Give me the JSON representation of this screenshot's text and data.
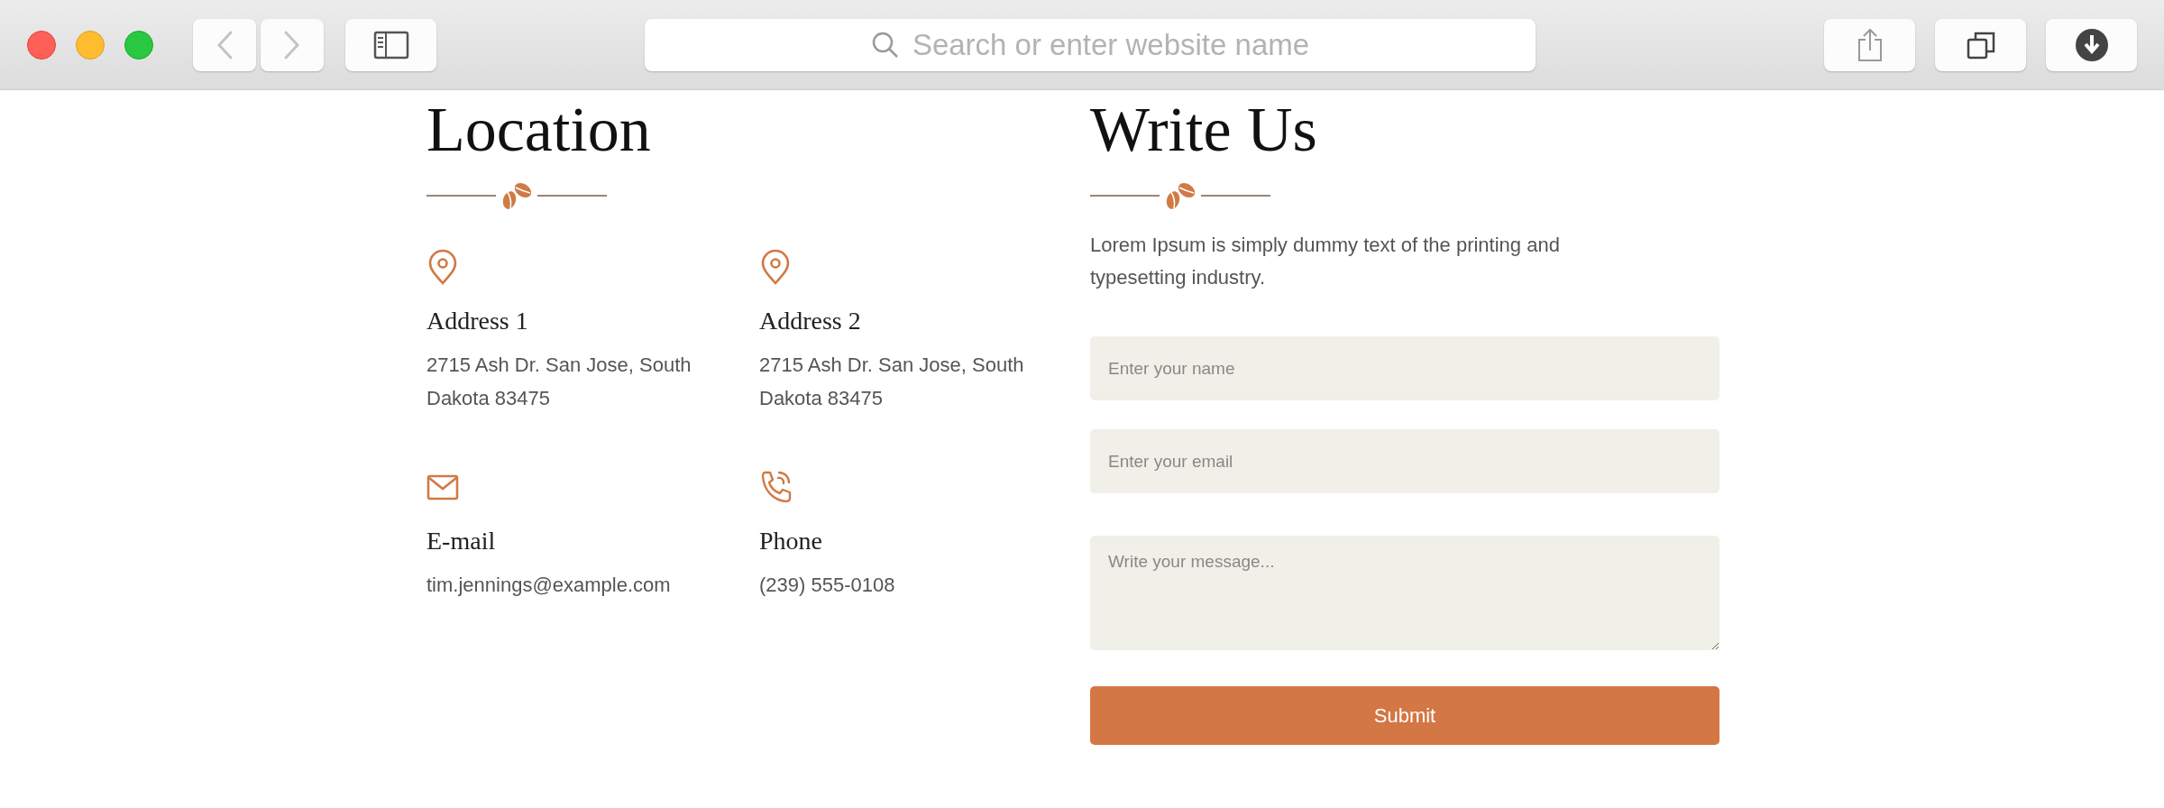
{
  "browser": {
    "search_placeholder": "Search or enter website name"
  },
  "location": {
    "title": "Location",
    "items": [
      {
        "kind": "pin",
        "title": "Address 1",
        "text": "2715 Ash Dr. San Jose, South Dakota 83475"
      },
      {
        "kind": "pin",
        "title": "Address 2",
        "text": "2715 Ash Dr. San Jose, South Dakota 83475"
      },
      {
        "kind": "mail",
        "title": "E-mail",
        "text": "tim.jennings@example.com"
      },
      {
        "kind": "phone",
        "title": "Phone",
        "text": "(239) 555-0108"
      }
    ]
  },
  "write_us": {
    "title": "Write Us",
    "description": "Lorem Ipsum is simply dummy text of the printing and typesetting industry.",
    "fields": [
      {
        "kind": "input",
        "placeholder": "Enter your name"
      },
      {
        "kind": "input",
        "placeholder": "Enter your email"
      },
      {
        "kind": "textarea",
        "placeholder": "Write your message..."
      }
    ],
    "submit": "Submit"
  }
}
